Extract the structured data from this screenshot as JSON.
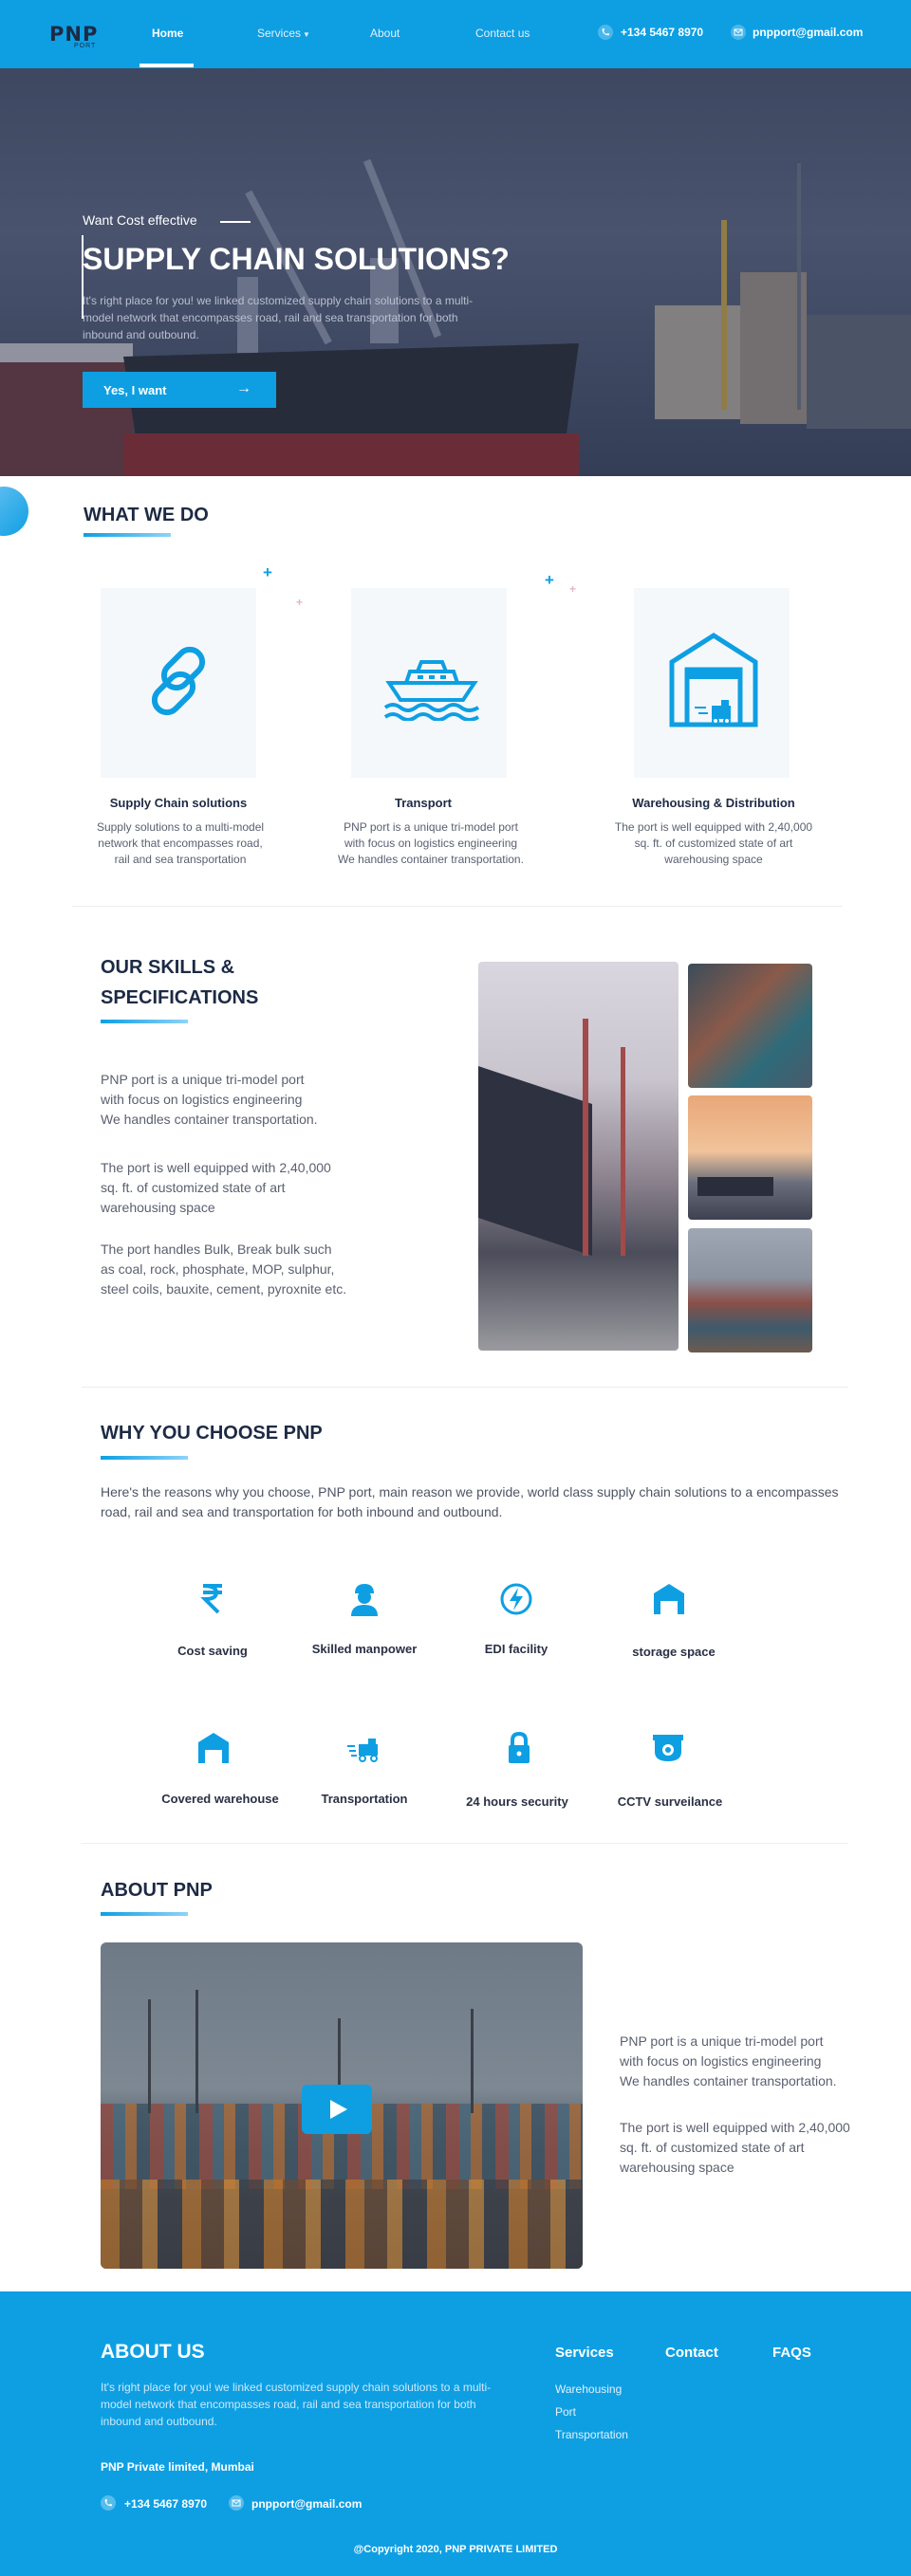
{
  "colors": {
    "primary": "#0e9fe3",
    "dark": "#1d2a44",
    "text": "#5b6070"
  },
  "brand": {
    "name": "PNP",
    "sub": "PORT"
  },
  "nav": {
    "items": [
      {
        "label": "Home",
        "active": true
      },
      {
        "label": "Services",
        "dropdown": true
      },
      {
        "label": "About"
      },
      {
        "label": "Contact us"
      }
    ],
    "phone": "+134 5467 8970",
    "email": "pnpport@gmail.com",
    "phone_icon": "phone-icon",
    "email_icon": "mail-icon"
  },
  "hero": {
    "kicker": "Want Cost effective",
    "title": "SUPPLY CHAIN SOLUTIONS?",
    "description": "It's right place for you! we linked customized supply chain solutions to a multi-model network that encompasses road, rail and sea transportation for both inbound  and outbound.",
    "cta": "Yes, I want",
    "cta_icon": "arrow-right-icon"
  },
  "what_we_do": {
    "title": "WHAT WE DO",
    "cards": [
      {
        "icon": "chain-link-icon",
        "title": "Supply Chain solutions",
        "desc_lines": [
          "Supply solutions to a multi-model",
          "network that encompasses road,",
          "rail and sea transportation"
        ]
      },
      {
        "icon": "ship-icon",
        "title": "Transport",
        "desc_lines": [
          "PNP port is a unique tri-model port",
          "with focus on logistics engineering",
          "We handles container transportation."
        ]
      },
      {
        "icon": "warehouse-icon",
        "title": "Warehousing & Distribution",
        "desc_lines": [
          "The port is well equipped with 2,40,000",
          "sq. ft. of customized state of art",
          "warehousing space"
        ]
      }
    ]
  },
  "skills": {
    "title_line1": "OUR SKILLS &",
    "title_line2": "SPECIFICATIONS",
    "para1": [
      "PNP port is a unique tri-model port",
      "with focus on logistics engineering",
      "We handles container transportation."
    ],
    "para2": [
      "The port is well equipped with 2,40,000",
      "sq. ft. of customized state of art",
      "warehousing space"
    ],
    "para3": [
      "The port handles Bulk, Break bulk such",
      "as coal, rock, phosphate, MOP, sulphur,",
      "steel coils, bauxite, cement, pyroxnite etc."
    ]
  },
  "why": {
    "title": "WHY YOU CHOOSE PNP",
    "description": "Here's the reasons why you choose, PNP port, main reason we provide, world class supply chain solutions to a encompasses road, rail and sea and transportation for both inbound and outbound.",
    "features": [
      {
        "icon": "rupee-icon",
        "label": "Cost saving"
      },
      {
        "icon": "worker-icon",
        "label": "Skilled manpower"
      },
      {
        "icon": "lightning-icon",
        "label": "EDI facility"
      },
      {
        "icon": "storage-icon",
        "label": "storage space"
      },
      {
        "icon": "warehouse-icon",
        "label": "Covered warehouse"
      },
      {
        "icon": "truck-icon",
        "label": "Transportation"
      },
      {
        "icon": "lock-icon",
        "label": "24 hours security"
      },
      {
        "icon": "cctv-icon",
        "label": "CCTV surveilance"
      }
    ]
  },
  "about": {
    "title": "ABOUT PNP",
    "para1": [
      "PNP port is a unique tri-model port",
      "with focus on logistics engineering",
      "We handles container transportation."
    ],
    "para2": [
      "The port is well equipped with 2,40,000",
      "sq. ft. of customized state of art",
      "warehousing space"
    ],
    "play_icon": "play-icon"
  },
  "footer": {
    "title": "ABOUT US",
    "description": "It's right place for you! we linked customized supply chain solutions to a multi-model network that encompasses road, rail and sea transportation for both inbound  and outbound.",
    "company": "PNP Private limited, Mumbai",
    "phone": "+134 5467 8970",
    "email": "pnpport@gmail.com",
    "col_services": "Services",
    "col_contact": "Contact",
    "col_faqs": "FAQS",
    "services_links": [
      "Warehousing",
      "Port",
      "Transportation"
    ],
    "copyright": "@Copyright 2020, PNP PRIVATE LIMITED"
  }
}
